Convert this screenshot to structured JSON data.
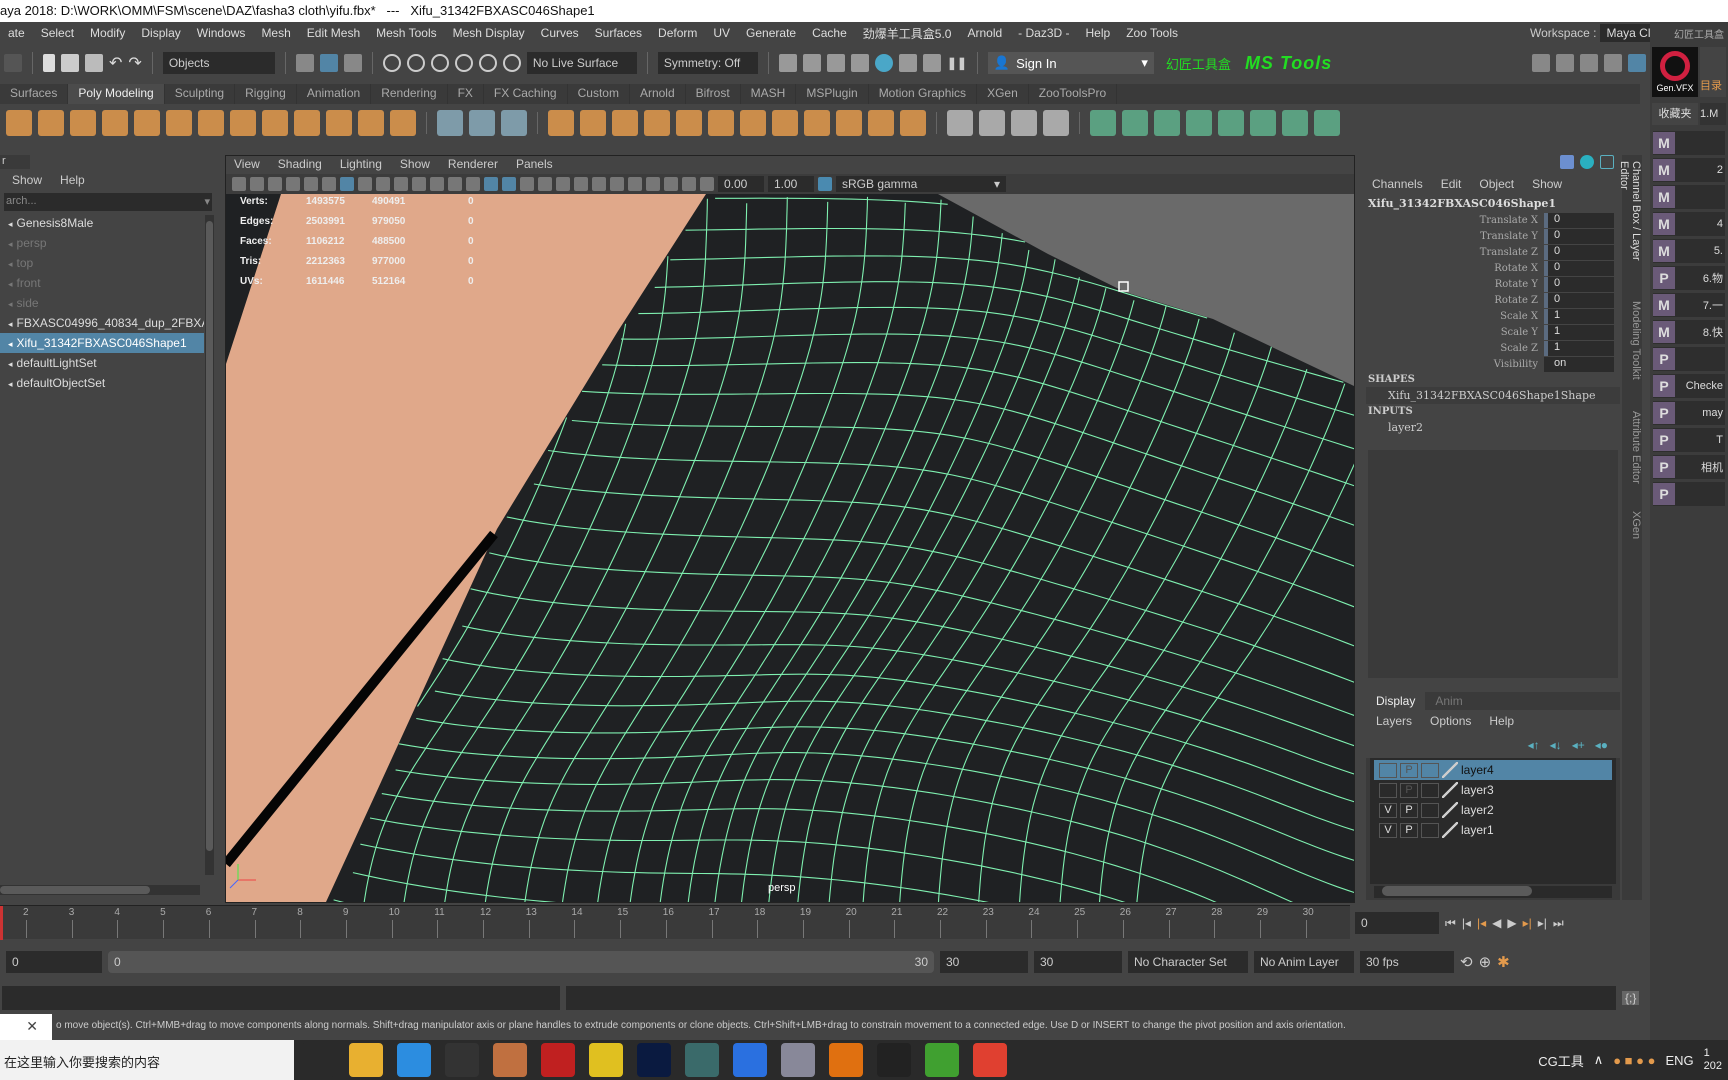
{
  "title": "aya 2018: D:\\WORK\\OMM\\FSM\\scene\\DAZ\\fasha3 cloth\\yifu.fbx*   ---   Xifu_31342FBXASC046Shape1",
  "menubar": [
    "ate",
    "Select",
    "Modify",
    "Display",
    "Windows",
    "Mesh",
    "Edit Mesh",
    "Mesh Tools",
    "Mesh Display",
    "Curves",
    "Surfaces",
    "Deform",
    "UV",
    "Generate",
    "Cache",
    "劲爆羊工具盒5.0",
    "Arnold",
    "- Daz3D -",
    "Help",
    "Zoo Tools"
  ],
  "workspace": {
    "label": "Workspace :",
    "value": "Maya Classic*"
  },
  "statusline": {
    "mode": "Objects",
    "live_surface": "No Live Surface",
    "symmetry": "Symmetry: Off",
    "sign_in": "Sign In",
    "toolbox": "幻匠工具盒",
    "ms_tools": "MS Tools"
  },
  "shelf_tabs": [
    "Surfaces",
    "Poly Modeling",
    "Sculpting",
    "Rigging",
    "Animation",
    "Rendering",
    "FX",
    "FX Caching",
    "Custom",
    "Arnold",
    "Bifrost",
    "MASH",
    "MSPlugin",
    "Motion Graphics",
    "XGen",
    "ZooToolsPro"
  ],
  "shelf_active": "Poly Modeling",
  "colors": {
    "accent": "#5285a6",
    "shelf_orange": "#e39a4c",
    "shelf_teal": "#5fb08c",
    "wire": "#7ff0b0",
    "skin": "#e0a88a",
    "cloth": "#1f2123",
    "viewport_bg": "#6a6a6a",
    "ms_green": "#22dd22"
  },
  "outliner": {
    "title": "r",
    "menu": [
      "Show",
      "Help"
    ],
    "search_placeholder": "arch...",
    "items": [
      {
        "label": "Genesis8Male",
        "state": "normal"
      },
      {
        "label": "persp",
        "state": "dim"
      },
      {
        "label": "top",
        "state": "dim"
      },
      {
        "label": "front",
        "state": "dim"
      },
      {
        "label": "side",
        "state": "dim"
      },
      {
        "label": "FBXASC04996_40834_dup_2FBXASC046",
        "state": "normal"
      },
      {
        "label": "Xifu_31342FBXASC046Shape1",
        "state": "selected"
      },
      {
        "label": "defaultLightSet",
        "state": "normal"
      },
      {
        "label": "defaultObjectSet",
        "state": "normal"
      }
    ]
  },
  "viewport": {
    "menu": [
      "View",
      "Shading",
      "Lighting",
      "Show",
      "Renderer",
      "Panels"
    ],
    "exposure": "0.00",
    "gamma": "1.00",
    "color_space": "sRGB gamma",
    "camera": "persp",
    "hud": [
      {
        "label": "Verts:",
        "v1": "1493575",
        "v2": "490491",
        "v3": "0"
      },
      {
        "label": "Edges:",
        "v1": "2503991",
        "v2": "979050",
        "v3": "0"
      },
      {
        "label": "Faces:",
        "v1": "1106212",
        "v2": "488500",
        "v3": "0"
      },
      {
        "label": "Tris:",
        "v1": "2212363",
        "v2": "977000",
        "v3": "0"
      },
      {
        "label": "UVs:",
        "v1": "1611446",
        "v2": "512164",
        "v3": "0"
      }
    ]
  },
  "channelbox": {
    "menu": [
      "Channels",
      "Edit",
      "Object",
      "Show"
    ],
    "object": "Xifu_31342FBXASC046Shape1",
    "attrs": [
      {
        "name": "Translate X",
        "value": "0"
      },
      {
        "name": "Translate Y",
        "value": "0"
      },
      {
        "name": "Translate Z",
        "value": "0"
      },
      {
        "name": "Rotate X",
        "value": "0"
      },
      {
        "name": "Rotate Y",
        "value": "0"
      },
      {
        "name": "Rotate Z",
        "value": "0"
      },
      {
        "name": "Scale X",
        "value": "1"
      },
      {
        "name": "Scale Y",
        "value": "1"
      },
      {
        "name": "Scale Z",
        "value": "1"
      },
      {
        "name": "Visibility",
        "value": "on"
      }
    ],
    "shapes_label": "SHAPES",
    "shape": "Xifu_31342FBXASC046Shape1Shape",
    "inputs_label": "INPUTS",
    "input": "layer2"
  },
  "layer_editor": {
    "tabs": [
      "Display",
      "Anim"
    ],
    "menu": [
      "Layers",
      "Options",
      "Help"
    ],
    "layers": [
      {
        "name": "layer4",
        "v": "",
        "p": "P",
        "selected": true
      },
      {
        "name": "layer3",
        "v": "",
        "p": "P",
        "selected": false
      },
      {
        "name": "layer2",
        "v": "V",
        "p": "P",
        "selected": false
      },
      {
        "name": "layer1",
        "v": "V",
        "p": "P",
        "selected": false
      }
    ]
  },
  "vertical_tabs": [
    "Channel Box / Layer Editor",
    "Modeling Toolkit",
    "Attribute Editor",
    "XGen"
  ],
  "right_shelf": {
    "header": "幻匠工具盒",
    "logo": "Gen.VFX",
    "catalog": "目录",
    "favorites": "收藏夹",
    "fav_item": "1.M",
    "buttons": [
      {
        "icon": "M",
        "label": ""
      },
      {
        "icon": "M",
        "label": "2"
      },
      {
        "icon": "M",
        "label": ""
      },
      {
        "icon": "M",
        "label": "4"
      },
      {
        "icon": "M",
        "label": "5."
      },
      {
        "icon": "P",
        "label": "6.物"
      },
      {
        "icon": "M",
        "label": "7.一"
      },
      {
        "icon": "M",
        "label": "8.快"
      },
      {
        "icon": "P",
        "label": ""
      },
      {
        "icon": "P",
        "label": "Checke"
      },
      {
        "icon": "P",
        "label": "may"
      },
      {
        "icon": "P",
        "label": "T"
      },
      {
        "icon": "P",
        "label": "相机"
      },
      {
        "icon": "P",
        "label": ""
      }
    ]
  },
  "timeline": {
    "ticks": [
      "2",
      "3",
      "4",
      "5",
      "6",
      "7",
      "8",
      "9",
      "10",
      "11",
      "12",
      "13",
      "14",
      "15",
      "16",
      "17",
      "18",
      "19",
      "20",
      "21",
      "22",
      "23",
      "24",
      "25",
      "26",
      "27",
      "28",
      "29",
      "30"
    ],
    "current_frame": "0"
  },
  "range": {
    "start": "0",
    "range_start": "0",
    "range_end": "30",
    "end": "30",
    "end2": "30",
    "character_set": "No Character Set",
    "anim_layer": "No Anim Layer",
    "fps": "30 fps"
  },
  "helpline": "o move object(s). Ctrl+MMB+drag to move components along normals. Shift+drag manipulator axis or plane handles to extrude components or clone objects. Ctrl+Shift+LMB+drag to constrain movement to a connected edge. Use D or INSERT to change the pivot position and axis orientation.",
  "taskbar": {
    "search_placeholder": "在这里输入你要搜索的内容",
    "apps": [
      "task-view",
      "file-explorer",
      "chrome",
      "obs",
      "app-avatar",
      "netease",
      "app-yellow",
      "photoshop",
      "maya",
      "app-blue",
      "app-gray",
      "search-app",
      "zbrush",
      "camtasia-green",
      "camtasia-red"
    ],
    "tray_label": "CG工具",
    "lang": "ENG",
    "clock": "1",
    "date": "202"
  }
}
